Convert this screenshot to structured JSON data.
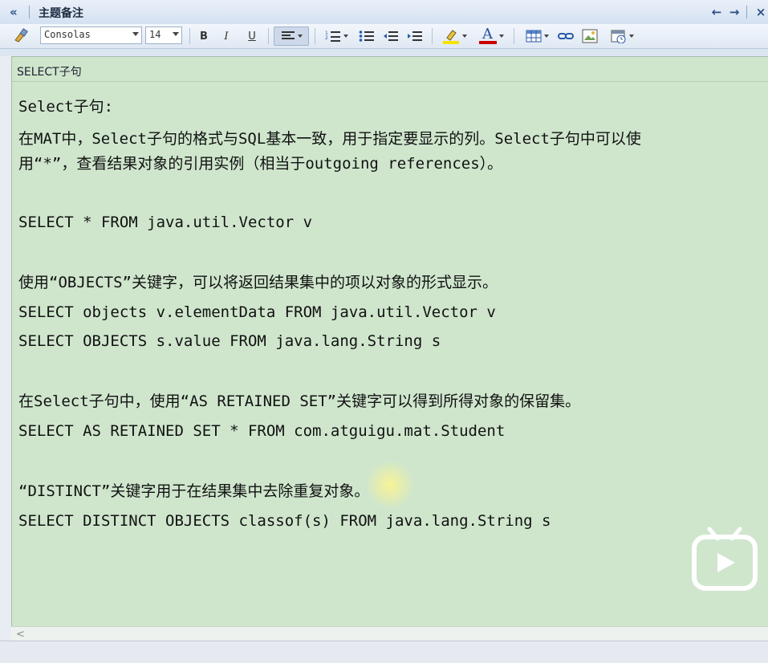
{
  "titlebar": {
    "title": "主题备注",
    "collapse_icon": "double-left-chevron-icon",
    "buttons": [
      "back-arrow-icon",
      "forward-arrow-icon",
      "close-icon"
    ]
  },
  "toolbar": {
    "font_name": "Consolas",
    "font_size": "14",
    "bold_label": "B",
    "italic_label": "I",
    "underline_label": "U",
    "font_color_label": "A",
    "highlight_color": "#f5e400",
    "font_color": "#cc0000"
  },
  "editor": {
    "subject": "SELECT子句",
    "background": "#cfe6cd",
    "lines": [
      "Select子句:",
      "在MAT中，Select子句的格式与SQL基本一致，用于指定要显示的列。Select子句中可以使",
      "用“*”，查看结果对象的引用实例（相当于outgoing references）。",
      "SELECT * FROM java.util.Vector v",
      "使用“OBJECTS”关键字，可以将返回结果集中的项以对象的形式显示。",
      "SELECT objects v.elementData FROM java.util.Vector v",
      "SELECT OBJECTS s.value FROM java.lang.String s",
      "在Select子句中，使用“AS RETAINED SET”关键字可以得到所得对象的保留集。",
      "SELECT AS RETAINED SET * FROM com.atguigu.mat.Student",
      "“DISTINCT”关键字用于在结果集中去除重复对象。",
      "SELECT DISTINCT OBJECTS classof(s) FROM java.lang.String s"
    ]
  }
}
